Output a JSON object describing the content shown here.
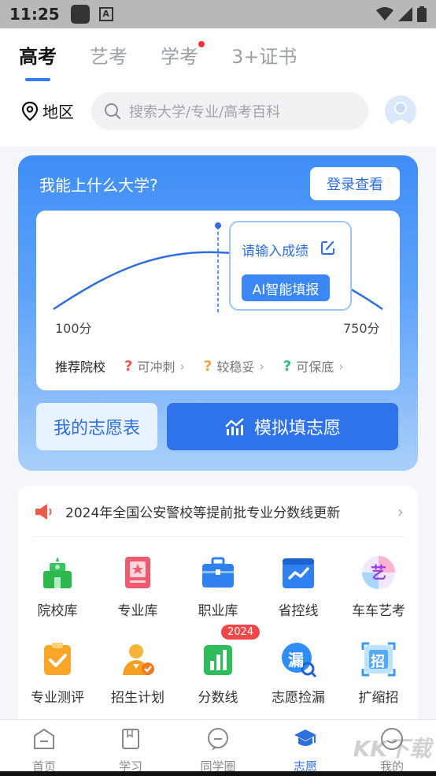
{
  "status_bar": {
    "time": "11:25"
  },
  "tabs": [
    {
      "label": "高考",
      "active": true
    },
    {
      "label": "艺考",
      "active": false
    },
    {
      "label": "学考",
      "active": false,
      "dot": true
    },
    {
      "label": "3+证书",
      "active": false
    }
  ],
  "region_label": "地区",
  "search": {
    "placeholder": "搜索大学/专业/高考百科"
  },
  "score_card": {
    "question": "我能上什么大学?",
    "login_button": "登录查看",
    "min_score": "100分",
    "max_score": "750分",
    "tip_text": "请输入成绩",
    "ai_button": "AI智能填报",
    "recommend_label": "推荐院校",
    "recommend_items": [
      {
        "label": "可冲刺",
        "mark": "?",
        "color": "#f05a4a"
      },
      {
        "label": "较稳妥",
        "mark": "?",
        "color": "#f5a24a"
      },
      {
        "label": "可保底",
        "mark": "?",
        "color": "#2ebd7a"
      }
    ],
    "my_wish_button": "我的志愿表",
    "simulate_button": "模拟填志愿"
  },
  "notice": {
    "text": "2024年全国公安警校等提前批专业分数线更新"
  },
  "grid_items": [
    {
      "label": "院校库",
      "icon": "school-icon"
    },
    {
      "label": "专业库",
      "icon": "major-icon"
    },
    {
      "label": "职业库",
      "icon": "briefcase-icon"
    },
    {
      "label": "省控线",
      "icon": "chart-line-icon"
    },
    {
      "label": "车车艺考",
      "icon": "art-exam-icon"
    },
    {
      "label": "专业测评",
      "icon": "clipboard-check-icon"
    },
    {
      "label": "招生计划",
      "icon": "enroll-plan-icon"
    },
    {
      "label": "分数线",
      "icon": "score-bars-icon",
      "badge": "2024"
    },
    {
      "label": "志愿捡漏",
      "icon": "wish-pickup-icon",
      "icon_text": "漏"
    },
    {
      "label": "扩缩招",
      "icon": "expand-enroll-icon",
      "icon_text": "招"
    }
  ],
  "bottom_nav": [
    {
      "label": "首页",
      "active": false
    },
    {
      "label": "学习",
      "active": false
    },
    {
      "label": "同学圈",
      "active": false
    },
    {
      "label": "志愿",
      "active": true
    },
    {
      "label": "我的",
      "active": false
    }
  ],
  "watermark": "KK下载"
}
